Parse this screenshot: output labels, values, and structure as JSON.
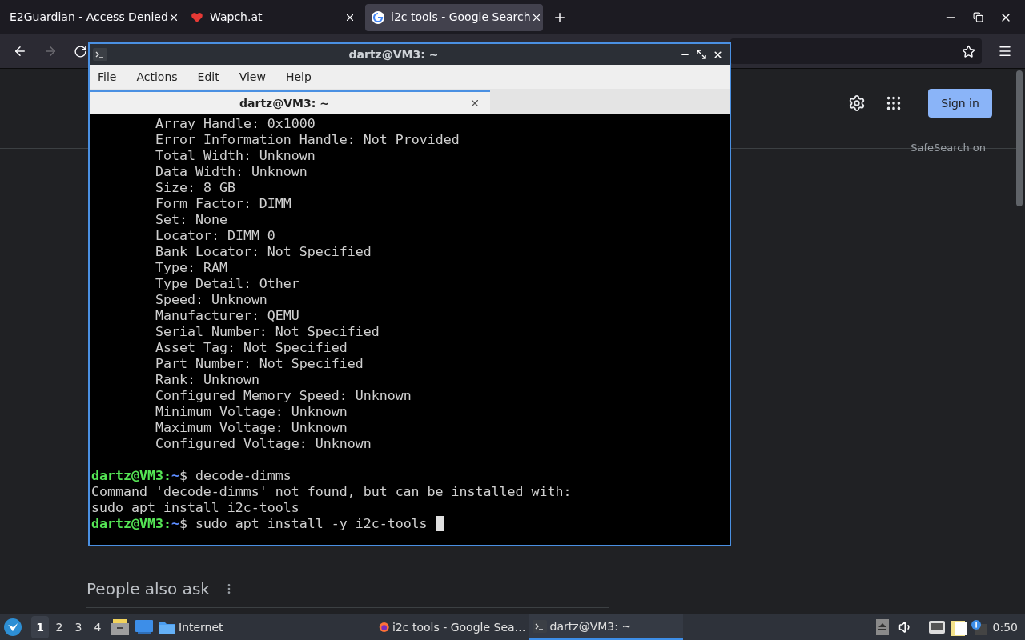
{
  "browser": {
    "tabs": [
      {
        "title": "E2Guardian - Access Denied",
        "kind": "plain",
        "selected": false
      },
      {
        "title": "Wapch.at",
        "kind": "heart",
        "selected": false
      },
      {
        "title": "i2c tools - Google Search",
        "kind": "google",
        "selected": true
      }
    ],
    "page": {
      "sign_in": "Sign in",
      "safesearch": "SafeSearch on",
      "people_also_ask": "People also ask"
    }
  },
  "terminal": {
    "title": "dartz@VM3: ~",
    "menu": [
      "File",
      "Actions",
      "Edit",
      "View",
      "Help"
    ],
    "tab": "dartz@VM3: ~",
    "lines": [
      {
        "kind": "detail",
        "text": "Array Handle: 0x1000"
      },
      {
        "kind": "detail",
        "text": "Error Information Handle: Not Provided"
      },
      {
        "kind": "detail",
        "text": "Total Width: Unknown"
      },
      {
        "kind": "detail",
        "text": "Data Width: Unknown"
      },
      {
        "kind": "detail",
        "text": "Size: 8 GB"
      },
      {
        "kind": "detail",
        "text": "Form Factor: DIMM"
      },
      {
        "kind": "detail",
        "text": "Set: None"
      },
      {
        "kind": "detail",
        "text": "Locator: DIMM 0"
      },
      {
        "kind": "detail",
        "text": "Bank Locator: Not Specified"
      },
      {
        "kind": "detail",
        "text": "Type: RAM"
      },
      {
        "kind": "detail",
        "text": "Type Detail: Other"
      },
      {
        "kind": "detail",
        "text": "Speed: Unknown"
      },
      {
        "kind": "detail",
        "text": "Manufacturer: QEMU"
      },
      {
        "kind": "detail",
        "text": "Serial Number: Not Specified"
      },
      {
        "kind": "detail",
        "text": "Asset Tag: Not Specified"
      },
      {
        "kind": "detail",
        "text": "Part Number: Not Specified"
      },
      {
        "kind": "detail",
        "text": "Rank: Unknown"
      },
      {
        "kind": "detail",
        "text": "Configured Memory Speed: Unknown"
      },
      {
        "kind": "detail",
        "text": "Minimum Voltage: Unknown"
      },
      {
        "kind": "detail",
        "text": "Maximum Voltage: Unknown"
      },
      {
        "kind": "detail",
        "text": "Configured Voltage: Unknown"
      },
      {
        "kind": "blank"
      },
      {
        "kind": "prompt",
        "user": "dartz@VM3:",
        "path": "~",
        "command": "$ decode-dimms",
        "cursor": false
      },
      {
        "kind": "output",
        "text": "Command 'decode-dimms' not found, but can be installed with:"
      },
      {
        "kind": "output",
        "text": "sudo apt install i2c-tools"
      },
      {
        "kind": "prompt",
        "user": "dartz@VM3:",
        "path": "~",
        "command": "$ sudo apt install -y i2c-tools",
        "cursor": true
      }
    ]
  },
  "taskbar": {
    "workspaces": [
      {
        "label": "1",
        "selected": true
      },
      {
        "label": "2",
        "selected": false
      },
      {
        "label": "3",
        "selected": false
      },
      {
        "label": "4",
        "selected": false
      }
    ],
    "launcher": "Internet",
    "tasks": [
      {
        "title": "i2c tools - Google Sea…",
        "kind": "firefox",
        "selected": false
      },
      {
        "title": "dartz@VM3: ~",
        "kind": "terminal",
        "selected": true
      }
    ],
    "clock": "0:50"
  }
}
